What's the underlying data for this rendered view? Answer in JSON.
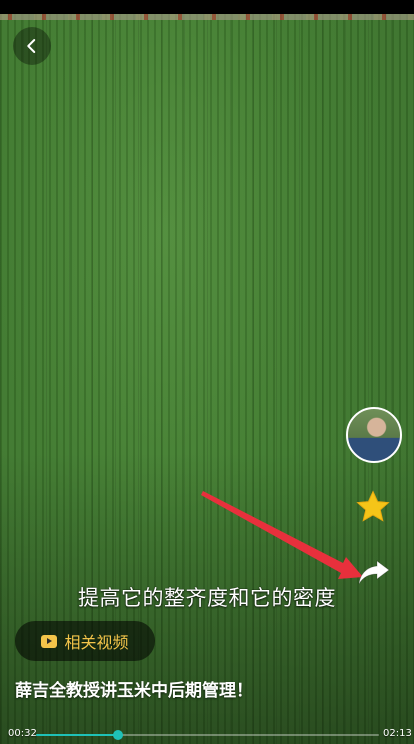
{
  "icons": {
    "back": "chevron-left-icon",
    "favorite": "star-icon",
    "share": "share-arrow-icon",
    "related": "play-square-icon"
  },
  "colors": {
    "accent": "#1fc1b7",
    "star": "#f5c518",
    "related_text": "#f3c44a",
    "annotation_arrow": "#e8303c"
  },
  "overlay": {
    "subtitle": "提高它的整齐度和它的密度"
  },
  "related_button": {
    "label": "相关视频"
  },
  "video": {
    "title": "薛吉全教授讲玉米中后期管理！"
  },
  "player": {
    "current_time": "00:32",
    "total_time": "02:13",
    "progress": 0.24
  }
}
